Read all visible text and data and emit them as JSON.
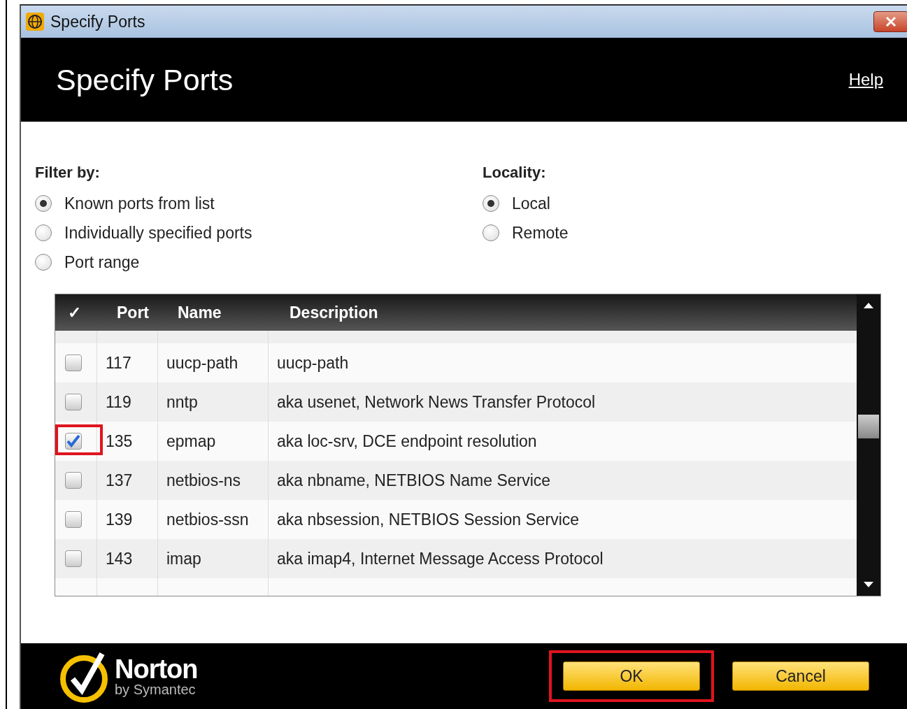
{
  "window": {
    "title": "Specify Ports"
  },
  "header": {
    "title": "Specify Ports",
    "help": "Help"
  },
  "filter": {
    "label": "Filter by:",
    "options": [
      {
        "label": "Known ports from list",
        "selected": true
      },
      {
        "label": "Individually specified ports",
        "selected": false
      },
      {
        "label": "Port range",
        "selected": false
      }
    ]
  },
  "locality": {
    "label": "Locality:",
    "options": [
      {
        "label": "Local",
        "selected": true
      },
      {
        "label": "Remote",
        "selected": false
      }
    ]
  },
  "table": {
    "columns": [
      "✓",
      "Port",
      "Name",
      "Description"
    ],
    "rows": [
      {
        "checked": false,
        "highlighted": false,
        "port": "117",
        "name": "uucp-path",
        "description": "uucp-path"
      },
      {
        "checked": false,
        "highlighted": false,
        "port": "119",
        "name": "nntp",
        "description": "aka usenet, Network News Transfer Protocol"
      },
      {
        "checked": true,
        "highlighted": true,
        "port": "135",
        "name": "epmap",
        "description": "aka loc-srv, DCE endpoint resolution"
      },
      {
        "checked": false,
        "highlighted": false,
        "port": "137",
        "name": "netbios-ns",
        "description": "aka nbname, NETBIOS Name Service"
      },
      {
        "checked": false,
        "highlighted": false,
        "port": "139",
        "name": "netbios-ssn",
        "description": "aka nbsession, NETBIOS Session Service"
      },
      {
        "checked": false,
        "highlighted": false,
        "port": "143",
        "name": "imap",
        "description": "aka imap4, Internet Message Access Protocol"
      }
    ]
  },
  "footer": {
    "logo": {
      "brand": "Norton",
      "tagline": "by Symantec"
    },
    "buttons": [
      {
        "label": "OK",
        "highlighted": true
      },
      {
        "label": "Cancel",
        "highlighted": false
      }
    ]
  }
}
